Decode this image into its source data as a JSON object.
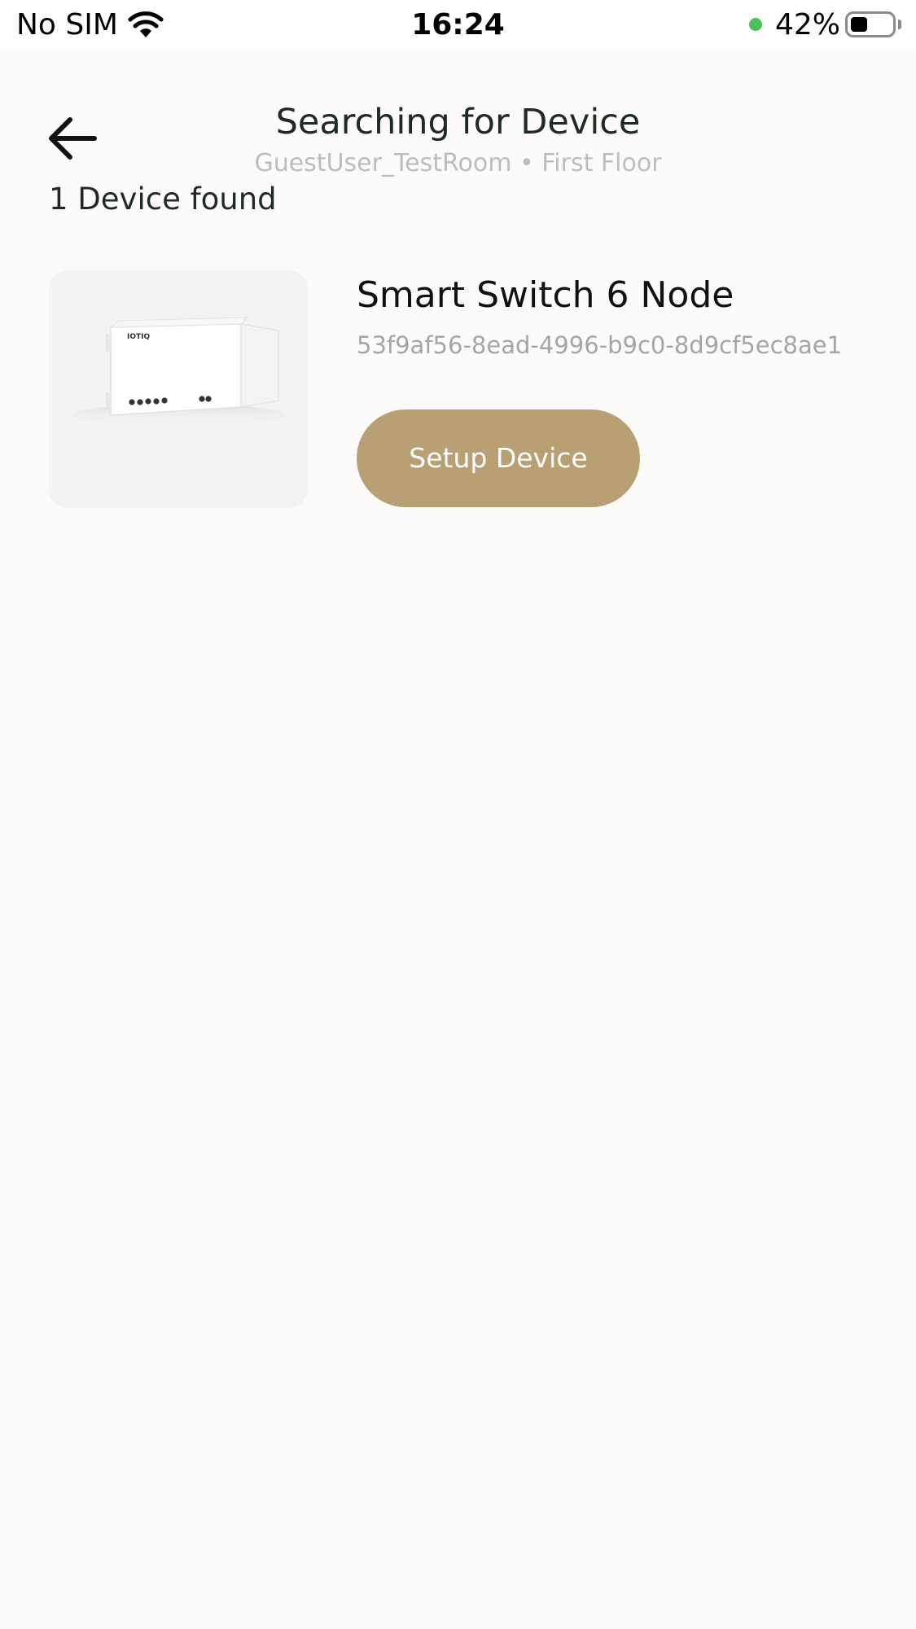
{
  "status_bar": {
    "carrier": "No SIM",
    "time": "16:24",
    "battery_percent": "42%",
    "battery_level": 0.42,
    "indicator_color": "#4cc15a"
  },
  "header": {
    "back_icon": "arrow-left-icon",
    "title": "Searching for Device",
    "subtitle": "GuestUser_TestRoom • First Floor"
  },
  "results": {
    "count_label": "1 Device found",
    "devices": [
      {
        "name": "Smart Switch 6 Node",
        "id": "53f9af56-8ead-4996-b9c0-8d9cf5ec8ae1",
        "image_brand_text": "IOTIQ",
        "setup_label": "Setup Device"
      }
    ]
  },
  "colors": {
    "background": "#fcfbf9",
    "accent": "#b89f74",
    "subtle_text": "#a6a6a6"
  }
}
